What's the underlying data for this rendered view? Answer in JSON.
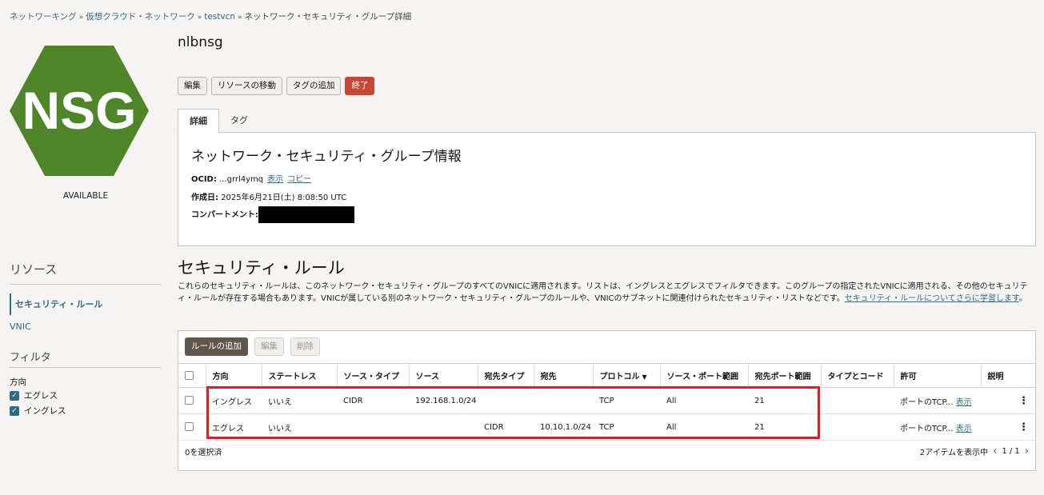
{
  "breadcrumb": {
    "networking": "ネットワーキング",
    "vcn_list": "仮想クラウド・ネットワーク",
    "vcn": "testvcn",
    "current": "ネットワーク・セキュリティ・グループ詳細",
    "separator": "»"
  },
  "logo": {
    "text": "NSG",
    "color": "#4e8528"
  },
  "status": "AVAILABLE",
  "sidebar": {
    "resources_title": "リソース",
    "items": [
      {
        "label": "セキュリティ・ルール"
      },
      {
        "label": "VNIC"
      }
    ],
    "filter_title": "フィルタ",
    "direction_label": "方向",
    "filters": [
      {
        "label": "エグレス",
        "checked": true
      },
      {
        "label": "イングレス",
        "checked": true
      }
    ]
  },
  "page": {
    "title": "nlbnsg"
  },
  "actions": {
    "edit": "編集",
    "move": "リソースの移動",
    "add_tag": "タグの追加",
    "terminate": "終了"
  },
  "tabs": {
    "details": "詳細",
    "tags": "タグ"
  },
  "info": {
    "heading": "ネットワーク・セキュリティ・グループ情報",
    "ocid_label": "OCID:",
    "ocid_value": "...grrl4ymq",
    "show": "表示",
    "copy": "コピー",
    "created_label": "作成日:",
    "created_value": "2025年6月21日(土) 8:08:50 UTC",
    "compartment_label": "コンパートメント:"
  },
  "security": {
    "title": "セキュリティ・ルール",
    "description": "これらのセキュリティ・ルールは、このネットワーク・セキュリティ・グループのすべてのVNICに適用されます。リストは、イングレスとエグレスでフィルタできます。このグループの指定されたVNICに適用される、その他のセキュリティ・ルールが存在する場合もあります。VNICが属している別のネットワーク・セキュリティ・グループのルールや、VNICのサブネットに関連付けられたセキュリティ・リストなどです。",
    "learn_more": "セキュリティ・ルールについてさらに学習します",
    "period": "。"
  },
  "table_toolbar": {
    "add_rule": "ルールの追加",
    "edit": "編集",
    "delete": "削除"
  },
  "table": {
    "headers": [
      "方向",
      "ステートレス",
      "ソース・タイプ",
      "ソース",
      "宛先タイプ",
      "宛先",
      "プロトコル",
      "ソース・ポート範囲",
      "宛先ポート範囲",
      "タイプとコード",
      "許可",
      "説明"
    ],
    "rows": [
      {
        "direction": "イングレス",
        "stateless": "いいえ",
        "source_type": "CIDR",
        "source": "192.168.1.0/24",
        "dest_type": "",
        "dest": "",
        "protocol": "TCP",
        "src_port": "All",
        "dst_port": "21",
        "type_code": "",
        "allows": "ポートのTCP...",
        "show": "表示"
      },
      {
        "direction": "エグレス",
        "stateless": "いいえ",
        "source_type": "",
        "source": "",
        "dest_type": "CIDR",
        "dest": "10.10.1.0/24",
        "protocol": "TCP",
        "src_port": "All",
        "dst_port": "21",
        "type_code": "",
        "allows": "ポートのTCP...",
        "show": "表示"
      }
    ],
    "selected": "0を選択済",
    "showing": "2アイテムを表示中",
    "pagination": "1 / 1"
  },
  "highlight_color": "#e01c24"
}
